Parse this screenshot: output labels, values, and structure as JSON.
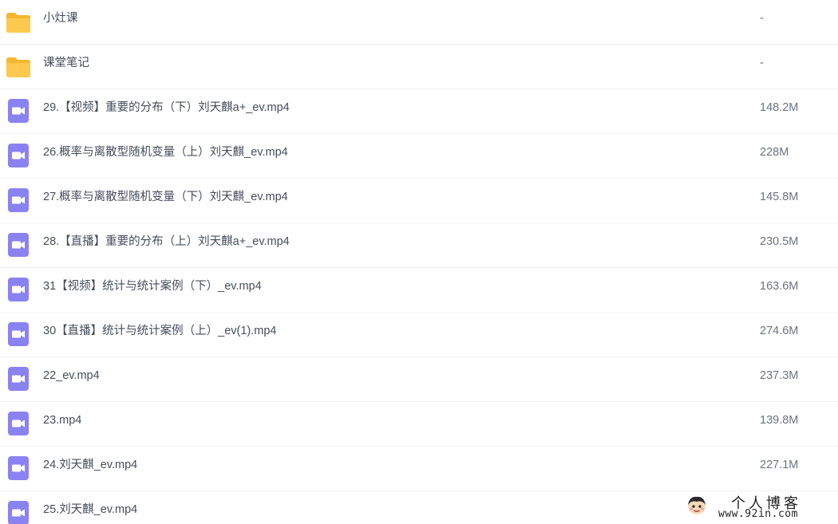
{
  "colors": {
    "folder": "#ffc94d",
    "folder_tab": "#f5b72f",
    "video": "#8b82f2",
    "row_divider": "#f1f2f4",
    "name_text": "#454d5a",
    "size_text": "#6b7280"
  },
  "files": [
    {
      "type": "folder",
      "icon": "folder-icon",
      "name": "小灶课",
      "size": "-"
    },
    {
      "type": "folder",
      "icon": "folder-icon",
      "name": "课堂笔记",
      "size": "-"
    },
    {
      "type": "video",
      "icon": "video-file-icon",
      "name": "29.【视频】重要的分布（下）刘天麒a+_ev.mp4",
      "size": "148.2M"
    },
    {
      "type": "video",
      "icon": "video-file-icon",
      "name": "26.概率与离散型随机变量（上）刘天麒_ev.mp4",
      "size": "228M"
    },
    {
      "type": "video",
      "icon": "video-file-icon",
      "name": "27.概率与离散型随机变量（下）刘天麒_ev.mp4",
      "size": "145.8M"
    },
    {
      "type": "video",
      "icon": "video-file-icon",
      "name": "28.【直播】重要的分布（上）刘天麒a+_ev.mp4",
      "size": "230.5M"
    },
    {
      "type": "video",
      "icon": "video-file-icon",
      "name": "31【视频】统计与统计案例（下）_ev.mp4",
      "size": "163.6M"
    },
    {
      "type": "video",
      "icon": "video-file-icon",
      "name": "30【直播】统计与统计案例（上）_ev(1).mp4",
      "size": "274.6M"
    },
    {
      "type": "video",
      "icon": "video-file-icon",
      "name": "22_ev.mp4",
      "size": "237.3M"
    },
    {
      "type": "video",
      "icon": "video-file-icon",
      "name": "23.mp4",
      "size": "139.8M"
    },
    {
      "type": "video",
      "icon": "video-file-icon",
      "name": "24.刘天麒_ev.mp4",
      "size": "227.1M"
    },
    {
      "type": "video",
      "icon": "video-file-icon",
      "name": "25.刘天麒_ev.mp4",
      "size": ""
    }
  ],
  "watermark": {
    "title": "个人博客",
    "url": "www.92in.com"
  }
}
